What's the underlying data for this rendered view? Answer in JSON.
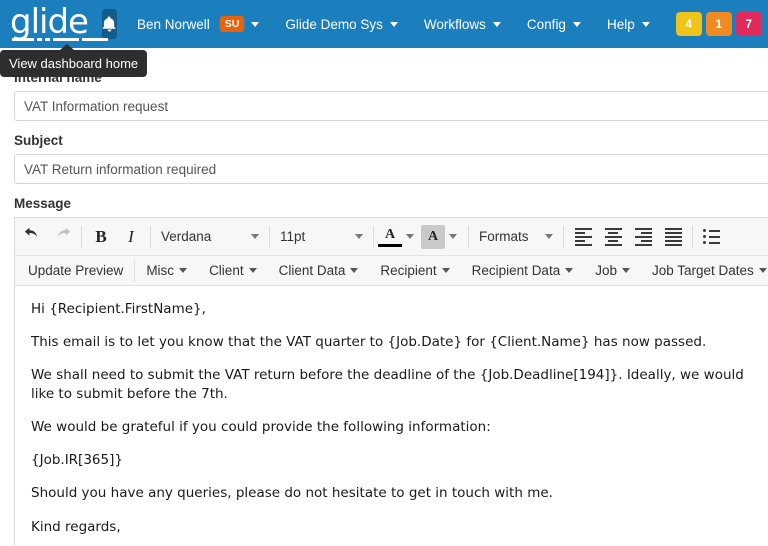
{
  "navbar": {
    "logo_text": "glide",
    "bell_icon": "bell-icon",
    "user": {
      "name": "Ben Norwell",
      "badge": "SU"
    },
    "items": [
      {
        "label": "Glide Demo Sys"
      },
      {
        "label": "Workflows"
      },
      {
        "label": "Config"
      },
      {
        "label": "Help"
      }
    ],
    "counters": [
      {
        "value": "4",
        "color": "#f0c419"
      },
      {
        "value": "1",
        "color": "#ef8b20"
      },
      {
        "value": "7",
        "color": "#e02a5b"
      }
    ],
    "background": "#1b7fbd"
  },
  "tooltip": {
    "text": "View dashboard home"
  },
  "form": {
    "internal_name": {
      "label": "Internal name",
      "value": "VAT Information request",
      "placeholder": "Internal name"
    },
    "subject": {
      "label": "Subject",
      "value": "VAT Return information required",
      "placeholder": "Subject"
    },
    "message": {
      "label": "Message"
    }
  },
  "editor": {
    "toolbar_row1": {
      "undo": "undo-icon",
      "redo": "redo-icon",
      "bold": "B",
      "italic": "I",
      "font_family": {
        "selected": "Verdana"
      },
      "font_size": {
        "selected": "11pt"
      },
      "forecolor": "A",
      "backcolor": "A",
      "formats": "Formats",
      "align_left": "align-left-icon",
      "align_center": "align-center-icon",
      "align_right": "align-right-icon",
      "align_justify": "align-justify-icon",
      "bullet_list": "bullet-list-icon"
    },
    "toolbar_row2": [
      {
        "label": "Update Preview",
        "dropdown": false
      },
      {
        "label": "Misc",
        "dropdown": true
      },
      {
        "label": "Client",
        "dropdown": true
      },
      {
        "label": "Client Data",
        "dropdown": true
      },
      {
        "label": "Recipient",
        "dropdown": true
      },
      {
        "label": "Recipient Data",
        "dropdown": true
      },
      {
        "label": "Job",
        "dropdown": true
      },
      {
        "label": "Job Target Dates",
        "dropdown": true
      }
    ],
    "body_paragraphs": [
      "Hi {Recipient.FirstName},",
      "This email is to let you know that the VAT quarter to {Job.Date} for {Client.Name} has now passed.",
      "We shall need to submit the VAT return before the deadline of the {Job.Deadline[194]}. Ideally, we would like to submit before the 7th.",
      "We would be grateful if you could provide the following information:",
      "{Job.IR[365]}",
      "Should you have any queries, please do not hesitate to get in touch with me.",
      "Kind regards,"
    ]
  }
}
